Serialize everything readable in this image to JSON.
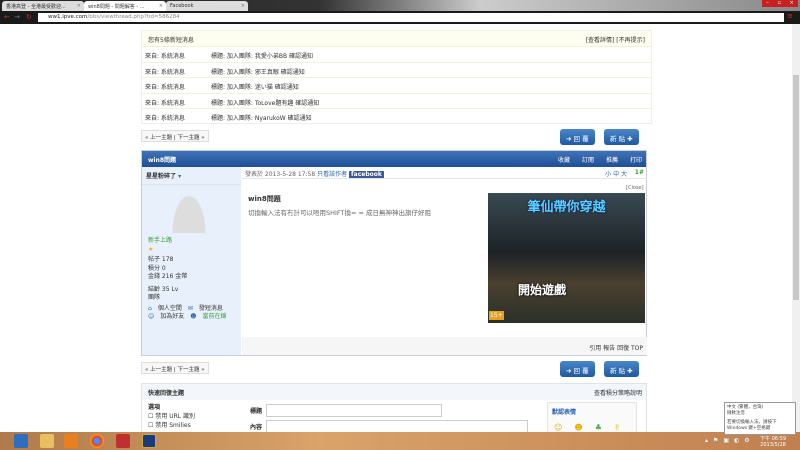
{
  "browser": {
    "tabs": [
      "香港高登 - 全港最受歡迎...",
      "win8問題 - 問題解答 - ...",
      "Facebook"
    ],
    "url_host": "ww1.ipve.com",
    "url_path": "/bbs/viewthread.php?tid=586284"
  },
  "notice": {
    "title": "您有5條新短消息",
    "links": "[查看詳情] [不再提示]",
    "rows": [
      {
        "from": "來自: 系統消息",
        "subject": "標題: 加入團隊: 我愛小弟BB 確認通知"
      },
      {
        "from": "來自: 系統消息",
        "subject": "標題: 加入團隊: 邪王真眼 確認通知"
      },
      {
        "from": "來自: 系統消息",
        "subject": "標題: 加入團隊: 迷い猫 確認通知"
      },
      {
        "from": "來自: 系統消息",
        "subject": "標題: 加入團隊: ToLove題有趣 確認通知"
      },
      {
        "from": "來自: 系統消息",
        "subject": "標題: 加入團隊: NyarukoW 確認通知"
      }
    ]
  },
  "nav": {
    "prev_next": "« 上一主題 | 下一主題 »",
    "reply": "➔ 回 覆",
    "new_post": "新 貼 ✚"
  },
  "post": {
    "thread_title": "win8問題",
    "actions": [
      "收藏",
      "訂閱",
      "推薦",
      "打印"
    ],
    "author": "星星粉碎了",
    "rank": "新手上路",
    "stats": [
      "帖子 178",
      "積分 0",
      "金錢 216 金幣"
    ],
    "age": "結齡 35 Lv",
    "team": "團隊",
    "user_links": [
      "個人空間",
      "發短消息",
      "加為好友",
      "當前在線"
    ],
    "meta": "發表於 2013-5-28 17:58",
    "only_author": "只看該作者",
    "facebook": "facebook",
    "font_sizes": "小 中 大",
    "floor": "1#",
    "title": "win8問題",
    "body": "切換輸入法有冇計可以唔用SHIFT換= = 成日無神神出旗仔好阻",
    "ad_close": "[Close]",
    "ad_title": "筆仙帶你穿越",
    "ad_button": "開始遊戲",
    "ad_rating": "15+",
    "footer": "引用 報告 回復 TOP"
  },
  "quick": {
    "title": "快速回復主題",
    "help": "查看積分策略說明",
    "options": "選項",
    "opt1": "禁用 URL 識別",
    "opt2": "禁用 Smilies",
    "subject_label": "標題",
    "content_label": "內容",
    "smilies": "默認表情"
  },
  "taskbar": {
    "time": "下午 06:59",
    "date": "2013/5/28"
  },
  "ime_tip": {
    "line1": "中文 (繁體，台灣)",
    "line2": "微軟注音",
    "line3": "若要切換輸入法，請按下",
    "line4": "Windows 鍵+空格鍵"
  }
}
